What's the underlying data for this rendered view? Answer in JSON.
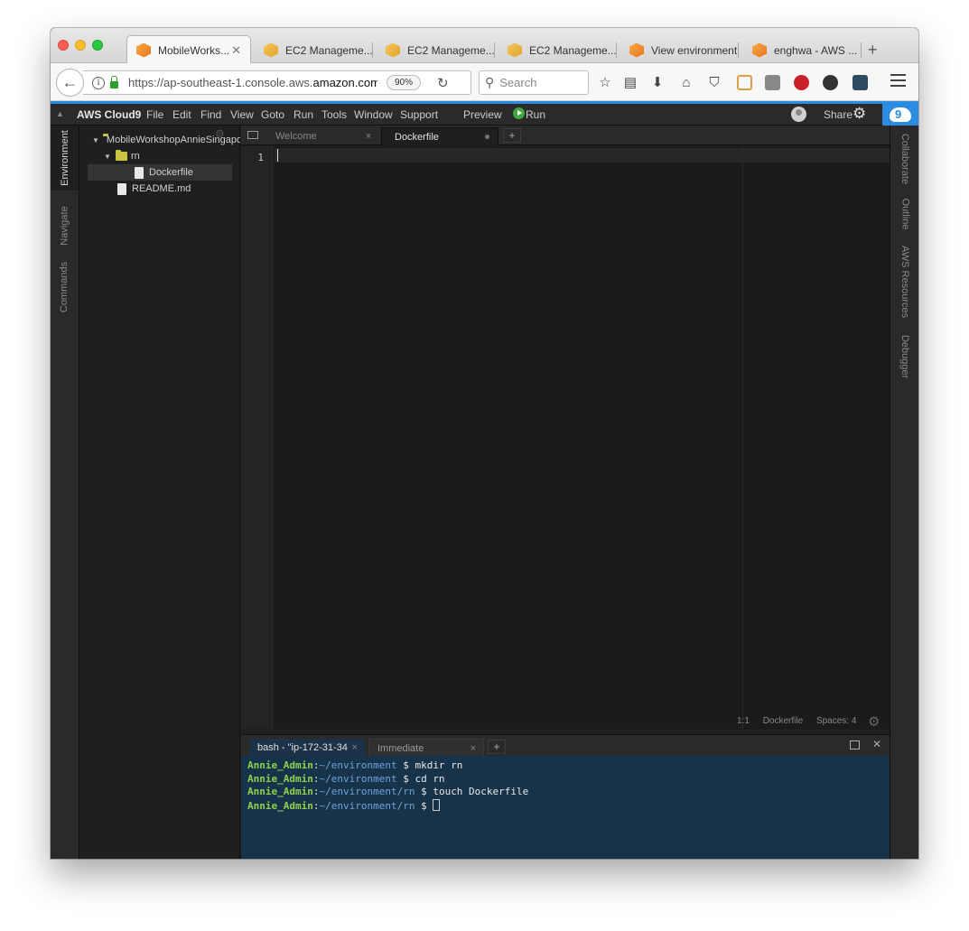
{
  "browser": {
    "tabs": [
      {
        "title": "MobileWorks...",
        "close": "✕",
        "icon": "cube-orange"
      },
      {
        "title": "EC2 Manageme...",
        "icon": "cube-yellow"
      },
      {
        "title": "EC2 Manageme...",
        "icon": "cube-yellow"
      },
      {
        "title": "EC2 Manageme...",
        "icon": "cube-yellow"
      },
      {
        "title": "View environment",
        "icon": "cube-orange"
      },
      {
        "title": "enghwa - AWS ...",
        "icon": "cube-orange"
      }
    ],
    "new_tab": "+",
    "url_prefix": "https://ap-southeast-1.console.aws.",
    "url_domain": "amazon.com",
    "zoom": "90%",
    "search_placeholder": "Search"
  },
  "cloud9": {
    "brand": "AWS Cloud9",
    "menu": [
      "File",
      "Edit",
      "Find",
      "View",
      "Goto",
      "Run",
      "Tools",
      "Window",
      "Support"
    ],
    "preview_label": "Preview",
    "run_label": "Run",
    "share_label": "Share",
    "logo_number": "9"
  },
  "left_panels": [
    "Environment",
    "Navigate",
    "Commands"
  ],
  "right_panels": [
    "Collaborate",
    "Outline",
    "AWS Resources",
    "Debugger"
  ],
  "file_tree": {
    "root": "MobileWorkshopAnnieSingapore",
    "folder": "rn",
    "file_in_folder": "Dockerfile",
    "root_file": "README.md"
  },
  "editor": {
    "tabs": [
      {
        "label": "Welcome",
        "close": "×"
      },
      {
        "label": "Dockerfile"
      }
    ],
    "plus": "+",
    "line_number": "1",
    "status": {
      "position": "1:1",
      "mode": "Dockerfile",
      "spaces": "Spaces: 4"
    }
  },
  "terminal": {
    "tabs": [
      {
        "label": "bash - \"ip-172-31-34",
        "close": "×"
      },
      {
        "label": "Immediate",
        "close": "×"
      }
    ],
    "plus": "+",
    "close": "✕",
    "lines": [
      {
        "user": "Annie_Admin",
        "path": "~/environment",
        "cmd": " $ mkdir rn"
      },
      {
        "user": "Annie_Admin",
        "path": "~/environment",
        "cmd": " $ cd rn"
      },
      {
        "user": "Annie_Admin",
        "path": "~/environment/rn",
        "cmd": " $ touch Dockerfile"
      },
      {
        "user": "Annie_Admin",
        "path": "~/environment/rn",
        "cmd": " $ "
      }
    ]
  },
  "colors": {
    "accent_blue": "#2b8ce0",
    "terminal_bg": "#16334a",
    "prompt_user": "#8fd04e",
    "prompt_path": "#6fa3d8"
  }
}
